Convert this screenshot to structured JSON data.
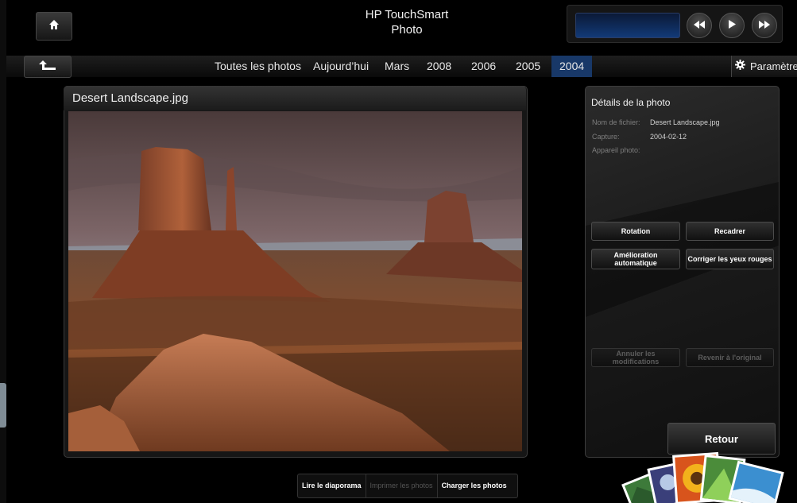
{
  "header": {
    "title_line1": "HP TouchSmart",
    "title_line2": "Photo"
  },
  "nav": {
    "items": [
      {
        "label": "Toutes les photos",
        "active": false
      },
      {
        "label": "Aujourd’hui",
        "active": false
      },
      {
        "label": "Mars",
        "active": false
      },
      {
        "label": "2008",
        "active": false
      },
      {
        "label": "2006",
        "active": false
      },
      {
        "label": "2005",
        "active": false
      },
      {
        "label": "2004",
        "active": true
      }
    ],
    "settings_label": "Paramètres"
  },
  "photo": {
    "title": "Desert Landscape.jpg"
  },
  "details": {
    "title": "Détails de la photo",
    "filename_label": "Nom de fichier:",
    "filename_value": "Desert Landscape.jpg",
    "capture_label": "Capture:",
    "capture_value": "2004-02-12",
    "camera_label": "Appareil photo:",
    "camera_value": ""
  },
  "actions": {
    "rotation": "Rotation",
    "recadrer": "Recadrer",
    "amelioration_line1": "Amélioration",
    "amelioration_line2": "automatique",
    "yeux_rouges": "Corriger les yeux rouges",
    "annuler": "Annuler les modifications",
    "revenir": "Revenir à l'original",
    "retour": "Retour"
  },
  "bottom": {
    "diaporama": "Lire le diaporama",
    "imprimer": "Imprimer les photos",
    "charger": "Charger les photos"
  },
  "icons": {
    "home": "home-icon",
    "back": "back-arrow-icon",
    "rewind": "rewind-icon",
    "play": "play-icon",
    "forward": "fast-forward-icon",
    "settings": "gear-icon"
  },
  "colors": {
    "accent": "#183868",
    "media_display": "#123a78"
  }
}
